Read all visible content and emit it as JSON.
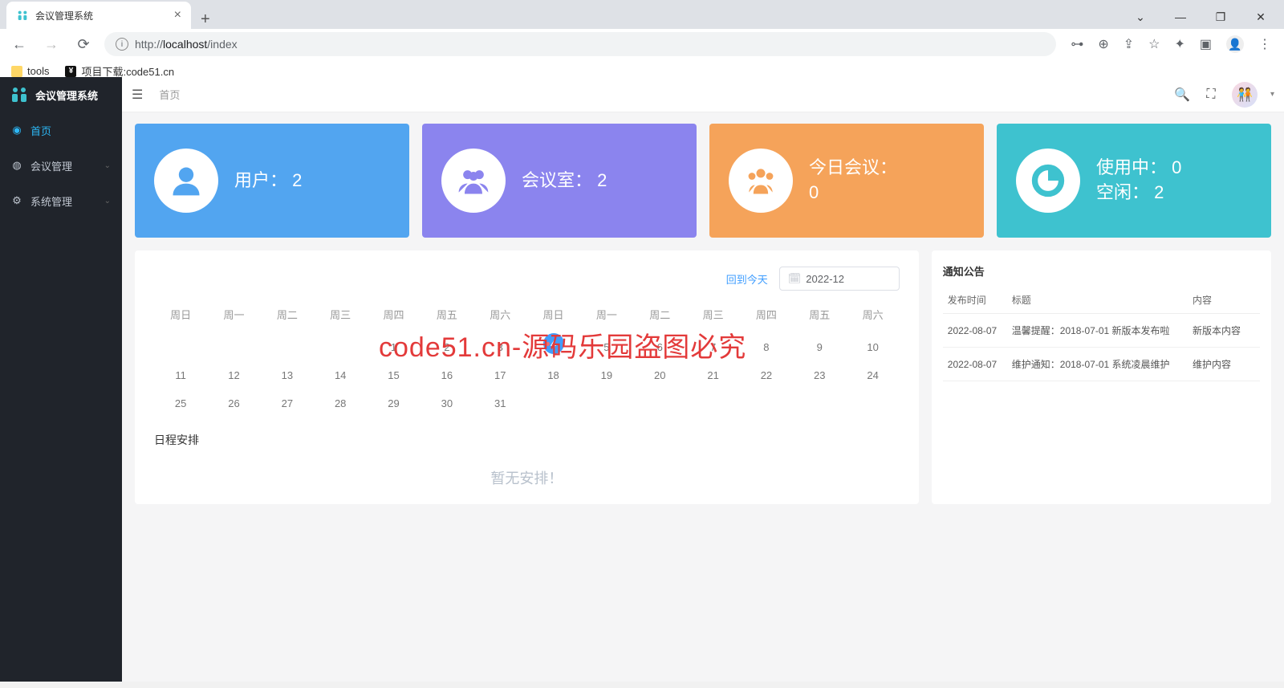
{
  "browser": {
    "tab_title": "会议管理系统",
    "url_display": "http://localhost/index",
    "url_prefix": "http://",
    "url_host": "localhost",
    "url_path": "/index",
    "bookmarks": [
      {
        "label": "tools",
        "icon": "folder"
      },
      {
        "label": "项目下载:code51.cn",
        "icon": "yuan"
      }
    ]
  },
  "app": {
    "brand": "会议管理系统",
    "breadcrumb": "首页",
    "sidebar": [
      {
        "label": "首页",
        "active": true,
        "expandable": false
      },
      {
        "label": "会议管理",
        "active": false,
        "expandable": true
      },
      {
        "label": "系统管理",
        "active": false,
        "expandable": true
      }
    ],
    "stats": {
      "users_label": "用户：",
      "users_value": "2",
      "rooms_label": "会议室：",
      "rooms_value": "2",
      "today_label": "今日会议：",
      "today_value": "0",
      "busy_label": "使用中：",
      "busy_value": "0",
      "idle_label": "空闲：",
      "idle_value": "2"
    },
    "calendar": {
      "back_today": "回到今天",
      "month_value": "2022-12",
      "weekdays": [
        "周日",
        "周一",
        "周二",
        "周三",
        "周四",
        "周五",
        "周六",
        "周日",
        "周一",
        "周二",
        "周三",
        "周四",
        "周五",
        "周六"
      ],
      "rows": [
        [
          "",
          "",
          "",
          "",
          "1",
          "2",
          "3",
          "4",
          "5",
          "6",
          "7",
          "8",
          "9",
          "10"
        ],
        [
          "11",
          "12",
          "13",
          "14",
          "15",
          "16",
          "17",
          "18",
          "19",
          "20",
          "21",
          "22",
          "23",
          "24"
        ],
        [
          "25",
          "26",
          "27",
          "28",
          "29",
          "30",
          "31",
          "",
          "",
          "",
          "",
          "",
          "",
          ""
        ]
      ],
      "today_cell": "4",
      "schedule_label": "日程安排",
      "no_schedule": "暂无安排！"
    },
    "notice": {
      "panel_title": "通知公告",
      "headers": [
        "发布时间",
        "标题",
        "内容"
      ],
      "rows": [
        {
          "date": "2022-08-07",
          "title": "温馨提醒：2018-07-01 新版本发布啦",
          "content": "新版本内容"
        },
        {
          "date": "2022-08-07",
          "title": "维护通知：2018-07-01 系统凌晨维护",
          "content": "维护内容"
        }
      ]
    }
  },
  "watermark": "code51.cn-源码乐园盗图必究"
}
